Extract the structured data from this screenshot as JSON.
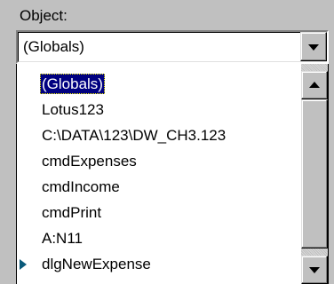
{
  "object_label": "Object:",
  "combo": {
    "value": "(Globals)"
  },
  "list": {
    "items": [
      {
        "label": "(Globals)",
        "selected": true
      },
      {
        "label": "Lotus123"
      },
      {
        "label": "C:\\DATA\\123\\DW_CH3.123"
      },
      {
        "label": "cmdExpenses"
      },
      {
        "label": "cmdIncome"
      },
      {
        "label": "cmdPrint"
      },
      {
        "label": "A:N11"
      },
      {
        "label": "dlgNewExpense",
        "has_marker": true
      }
    ]
  },
  "icons": {
    "combo_dropdown": "chevron-down-icon",
    "scroll_up": "arrow-up-icon",
    "scroll_down": "arrow-down-icon",
    "item_marker": "triangle-right-icon"
  },
  "colors": {
    "face": "#c0c0c0",
    "selection_bg": "#000080",
    "selection_text": "#ffffff",
    "marker": "#0a5a7a"
  }
}
